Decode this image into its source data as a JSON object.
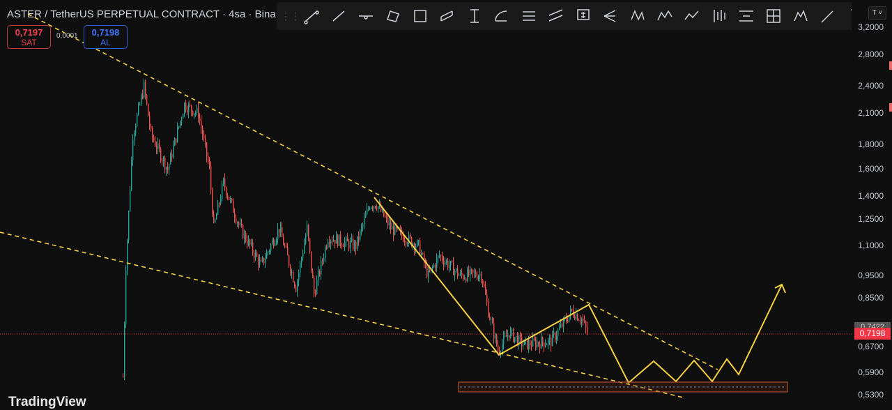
{
  "header": {
    "title": "ASTER / TetherUS PERPETUAL CONTRACT · 4sa · Bina"
  },
  "trade": {
    "sell_price": "0,7197",
    "sell_label": "SAT",
    "spread": "0,0001",
    "buy_price": "0,7198",
    "buy_label": "AL"
  },
  "toolbar": {
    "tools": [
      "trend-line",
      "ray",
      "horizontal-ray",
      "parallel-channel",
      "rectangle",
      "disjoint-channel",
      "text-range",
      "arc",
      "price-range",
      "flat-channel",
      "price-note",
      "pitchfork",
      "xabcd-pattern",
      "elliott-wave",
      "path",
      "bars-pattern",
      "date-price-range",
      "fib-channel",
      "head-shoulders",
      "brush",
      "text"
    ]
  },
  "price_axis": {
    "unit_label": "T ˅",
    "ticks": [
      "3,2000",
      "2,8000",
      "2,4000",
      "2,1000",
      "1,8000",
      "1,6000",
      "1,4000",
      "1,2500",
      "1,1000",
      "0,9500",
      "0,8500",
      "0,6700",
      "0,5900",
      "0,5300"
    ],
    "current_price": "0,7198",
    "marker_price": "0,7422"
  },
  "brand": {
    "logo": "TradingView"
  },
  "colors": {
    "up": "#26a69a",
    "down": "#ef5350",
    "drawing": "#f5d142",
    "current": "#f23645"
  },
  "price_path": [
    [
      0,
      0.58
    ],
    [
      2,
      1.0
    ],
    [
      7,
      1.9
    ],
    [
      15,
      2.4
    ],
    [
      20,
      1.9
    ],
    [
      32,
      1.6
    ],
    [
      44,
      2.2
    ],
    [
      54,
      2.1
    ],
    [
      62,
      1.6
    ],
    [
      65,
      1.2
    ],
    [
      72,
      1.5
    ],
    [
      84,
      1.2
    ],
    [
      99,
      1.0
    ],
    [
      112,
      1.2
    ],
    [
      124,
      0.9
    ],
    [
      132,
      1.2
    ],
    [
      137,
      0.87
    ],
    [
      147,
      1.15
    ],
    [
      167,
      1.1
    ],
    [
      177,
      1.35
    ],
    [
      182,
      1.35
    ],
    [
      192,
      1.2
    ],
    [
      212,
      1.1
    ],
    [
      219,
      0.95
    ],
    [
      227,
      1.05
    ],
    [
      242,
      0.95
    ],
    [
      257,
      0.96
    ],
    [
      262,
      0.8
    ],
    [
      269,
      0.66
    ],
    [
      277,
      0.72
    ],
    [
      287,
      0.68
    ],
    [
      307,
      0.69
    ],
    [
      322,
      0.8
    ],
    [
      329,
      0.77
    ],
    [
      333,
      0.72
    ]
  ]
}
